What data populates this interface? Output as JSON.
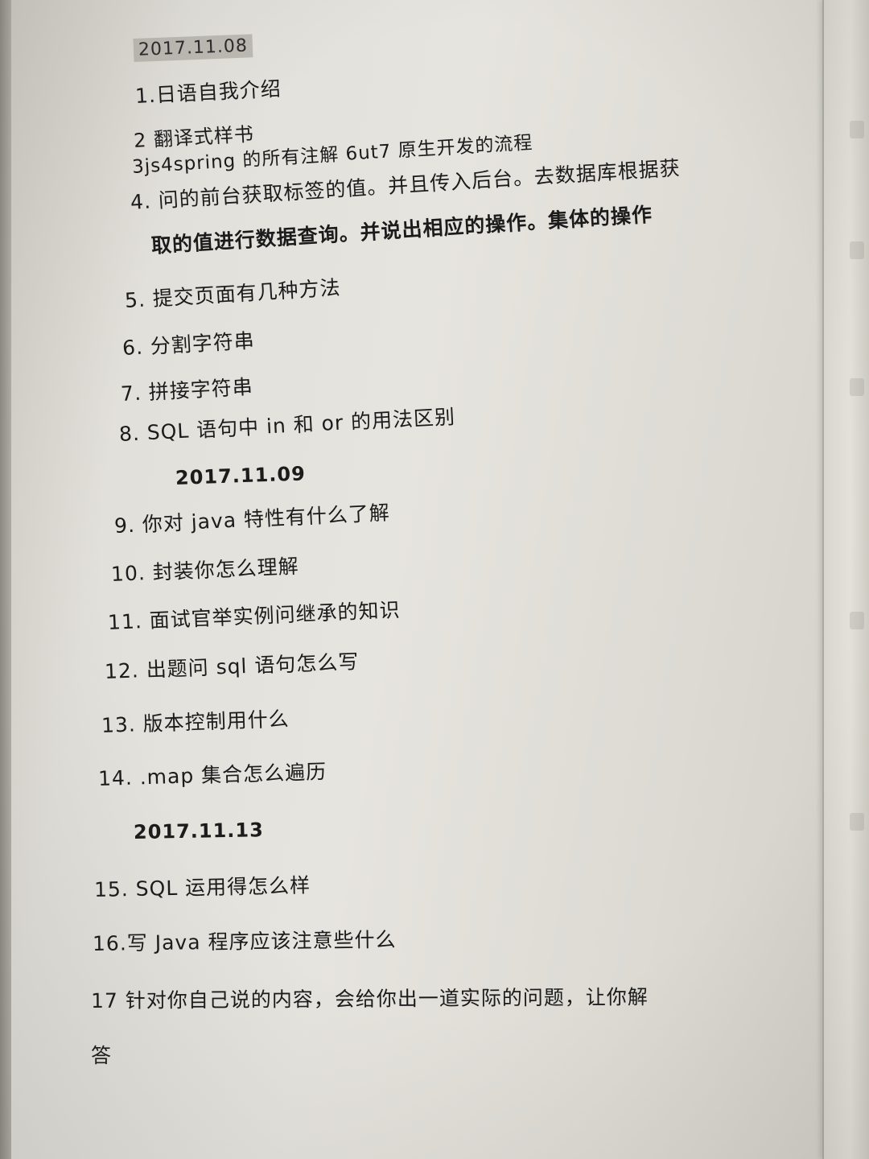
{
  "document": {
    "lines": [
      {
        "id": "date1",
        "text": "2017.11.08"
      },
      {
        "id": "q1",
        "text": "1.日语自我介绍"
      },
      {
        "id": "q2",
        "text": "2 翻译式样书"
      },
      {
        "id": "q3",
        "text": "3js4spring 的所有注解 6ut7 原生开发的流程"
      },
      {
        "id": "q4a",
        "text": "4. 问的前台获取标签的值。并且传入后台。去数据库根据获"
      },
      {
        "id": "q4b",
        "text": "取的值进行数据查询。并说出相应的操作。集体的操作"
      },
      {
        "id": "q5",
        "text": "5. 提交页面有几种方法"
      },
      {
        "id": "q6",
        "text": "6. 分割字符串"
      },
      {
        "id": "q7",
        "text": "7. 拼接字符串"
      },
      {
        "id": "q8",
        "text": "8. SQL 语句中 in 和 or 的用法区别"
      },
      {
        "id": "date2",
        "text": "2017.11.09"
      },
      {
        "id": "q9",
        "text": "9. 你对 java 特性有什么了解"
      },
      {
        "id": "q10",
        "text": "10. 封装你怎么理解"
      },
      {
        "id": "q11",
        "text": "11. 面试官举实例问继承的知识"
      },
      {
        "id": "q12",
        "text": "12. 出题问 sql 语句怎么写"
      },
      {
        "id": "q13",
        "text": "13. 版本控制用什么"
      },
      {
        "id": "q14",
        "text": "14. .map 集合怎么遍历"
      },
      {
        "id": "date3",
        "text": "2017.11.13"
      },
      {
        "id": "q15",
        "text": "15. SQL 运用得怎么样"
      },
      {
        "id": "q16",
        "text": "16.写 Java 程序应该注意些什么"
      },
      {
        "id": "q17a",
        "text": "17 针对你自己说的内容，会给你出一道实际的问题，让你解"
      },
      {
        "id": "q17b",
        "text": "答"
      }
    ]
  }
}
